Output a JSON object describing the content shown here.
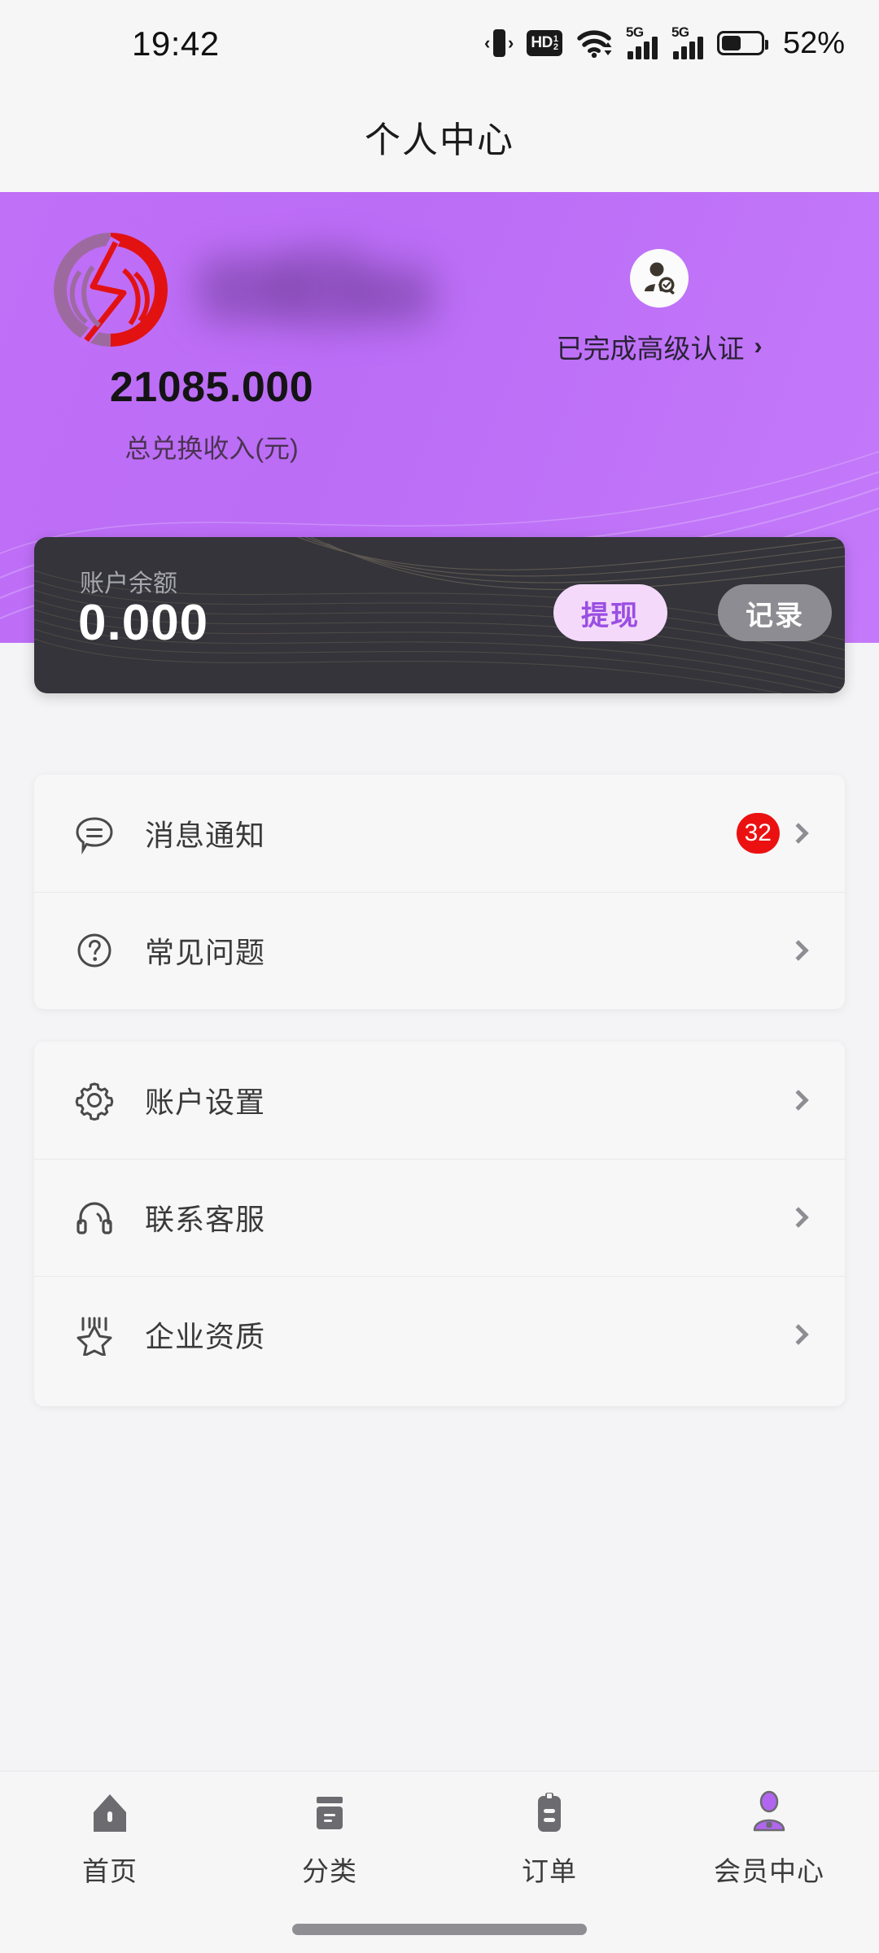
{
  "status_bar": {
    "time": "19:42",
    "battery_percent": "52%",
    "battery_level": 52,
    "icons": [
      "vibrate-icon",
      "hd-volte-icon",
      "wifi-icon",
      "signal-5g-sim1-icon",
      "signal-5g-sim2-icon",
      "battery-icon"
    ],
    "hd_label": "HD",
    "hd_sim_top": "1",
    "hd_sim_bottom": "2",
    "net_label_1": "5G",
    "net_label_2": "5G"
  },
  "header": {
    "title": "个人中心"
  },
  "hero": {
    "income_value": "21085.000",
    "income_label": "总兑换收入(元)",
    "verify_text": "已完成高级认证",
    "verify_chevron": "›",
    "verify_icon": "verified-user-icon",
    "logo_icon": "brand-logo-icon",
    "accent_purple": "#bb6df6",
    "logo_red": "#e21212",
    "logo_mauve": "#9d6aa0"
  },
  "balance": {
    "label": "账户余额",
    "value": "0.000",
    "withdraw_label": "提现",
    "record_label": "记录",
    "card_bg": "#34343a",
    "withdraw_bg": "#f4d9fb",
    "withdraw_fg": "#9a4ee2",
    "record_bg": "#8c8c92"
  },
  "menu_card_1": {
    "rows": [
      {
        "icon": "message-bubble-icon",
        "label": "消息通知",
        "badge": "32"
      },
      {
        "icon": "question-circle-icon",
        "label": "常见问题",
        "badge": ""
      }
    ]
  },
  "menu_card_2": {
    "rows": [
      {
        "icon": "gear-icon",
        "label": "账户设置",
        "badge": ""
      },
      {
        "icon": "headset-icon",
        "label": "联系客服",
        "badge": ""
      },
      {
        "icon": "award-star-icon",
        "label": "企业资质",
        "badge": ""
      }
    ]
  },
  "bottom_nav": {
    "items": [
      {
        "icon": "home-icon",
        "label": "首页",
        "active": false
      },
      {
        "icon": "category-icon",
        "label": "分类",
        "active": false
      },
      {
        "icon": "order-icon",
        "label": "订单",
        "active": false
      },
      {
        "icon": "member-icon",
        "label": "会员中心",
        "active": true
      }
    ],
    "active_color": "#b266f0",
    "inactive_color": "#6b6b70"
  }
}
